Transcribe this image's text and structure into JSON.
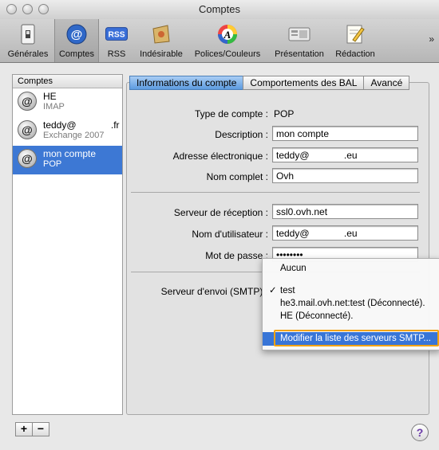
{
  "window": {
    "title": "Comptes"
  },
  "toolbar": {
    "items": [
      {
        "label": "Générales",
        "icon": "light-switch-icon"
      },
      {
        "label": "Comptes",
        "icon": "at-sign-icon"
      },
      {
        "label": "RSS",
        "icon": "rss-icon"
      },
      {
        "label": "Indésirable",
        "icon": "junk-mail-icon"
      },
      {
        "label": "Polices/Couleurs",
        "icon": "font-colors-icon"
      },
      {
        "label": "Présentation",
        "icon": "presentation-icon"
      },
      {
        "label": "Rédaction",
        "icon": "compose-pencil-icon"
      }
    ],
    "overflow": "»"
  },
  "sidebar": {
    "header": "Comptes",
    "accounts": [
      {
        "name": "HE",
        "type": "IMAP"
      },
      {
        "name": "teddy@             .fr",
        "type": "Exchange 2007"
      },
      {
        "name": "mon compte",
        "type": "POP"
      }
    ],
    "add_label": "+",
    "remove_label": "−"
  },
  "tabs": [
    "Informations du compte",
    "Comportements des BAL",
    "Avancé"
  ],
  "form": {
    "type_label": "Type de compte :",
    "type_value": "POP",
    "description_label": "Description :",
    "description_value": "mon compte",
    "email_label": "Adresse électronique :",
    "email_value": "teddy@             .eu",
    "fullname_label": "Nom complet :",
    "fullname_value": "Ovh",
    "incoming_label": "Serveur de réception :",
    "incoming_value": "ssl0.ovh.net",
    "username_label": "Nom d'utilisateur :",
    "username_value": "teddy@             .eu",
    "password_label": "Mot de passe :",
    "password_value": "••••••••",
    "smtp_label": "Serveur d'envoi (SMTP) :"
  },
  "smtp_menu": {
    "items": [
      "Aucun",
      "test",
      "he3.mail.ovh.net:test (Déconnecté).",
      "HE (Déconnecté).",
      "Modifier la liste des serveurs SMTP..."
    ],
    "checked": "✓"
  },
  "help": "?",
  "colors": {
    "selection": "#3d78d4",
    "highlight": "#3875d7",
    "callout": "#f3a310"
  }
}
